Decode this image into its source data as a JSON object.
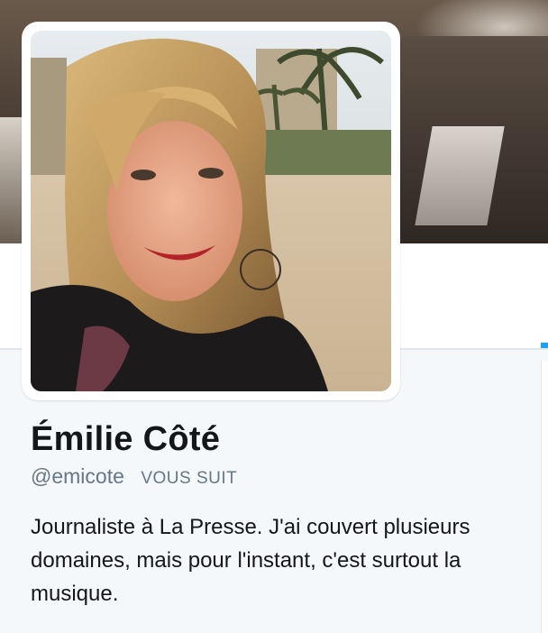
{
  "profile": {
    "name": "Émilie Côté",
    "handle": "@emicote",
    "follows_you": "VOUS SUIT",
    "bio": "Journaliste à La Presse. J'ai couvert plusieurs domaines, mais pour l'instant, c'est surtout la musique."
  },
  "colors": {
    "text_primary": "#14171a",
    "text_secondary": "#657786",
    "accent": "#1da1f2",
    "page_bg": "#f5f8fa",
    "border": "#e1e8ed"
  }
}
